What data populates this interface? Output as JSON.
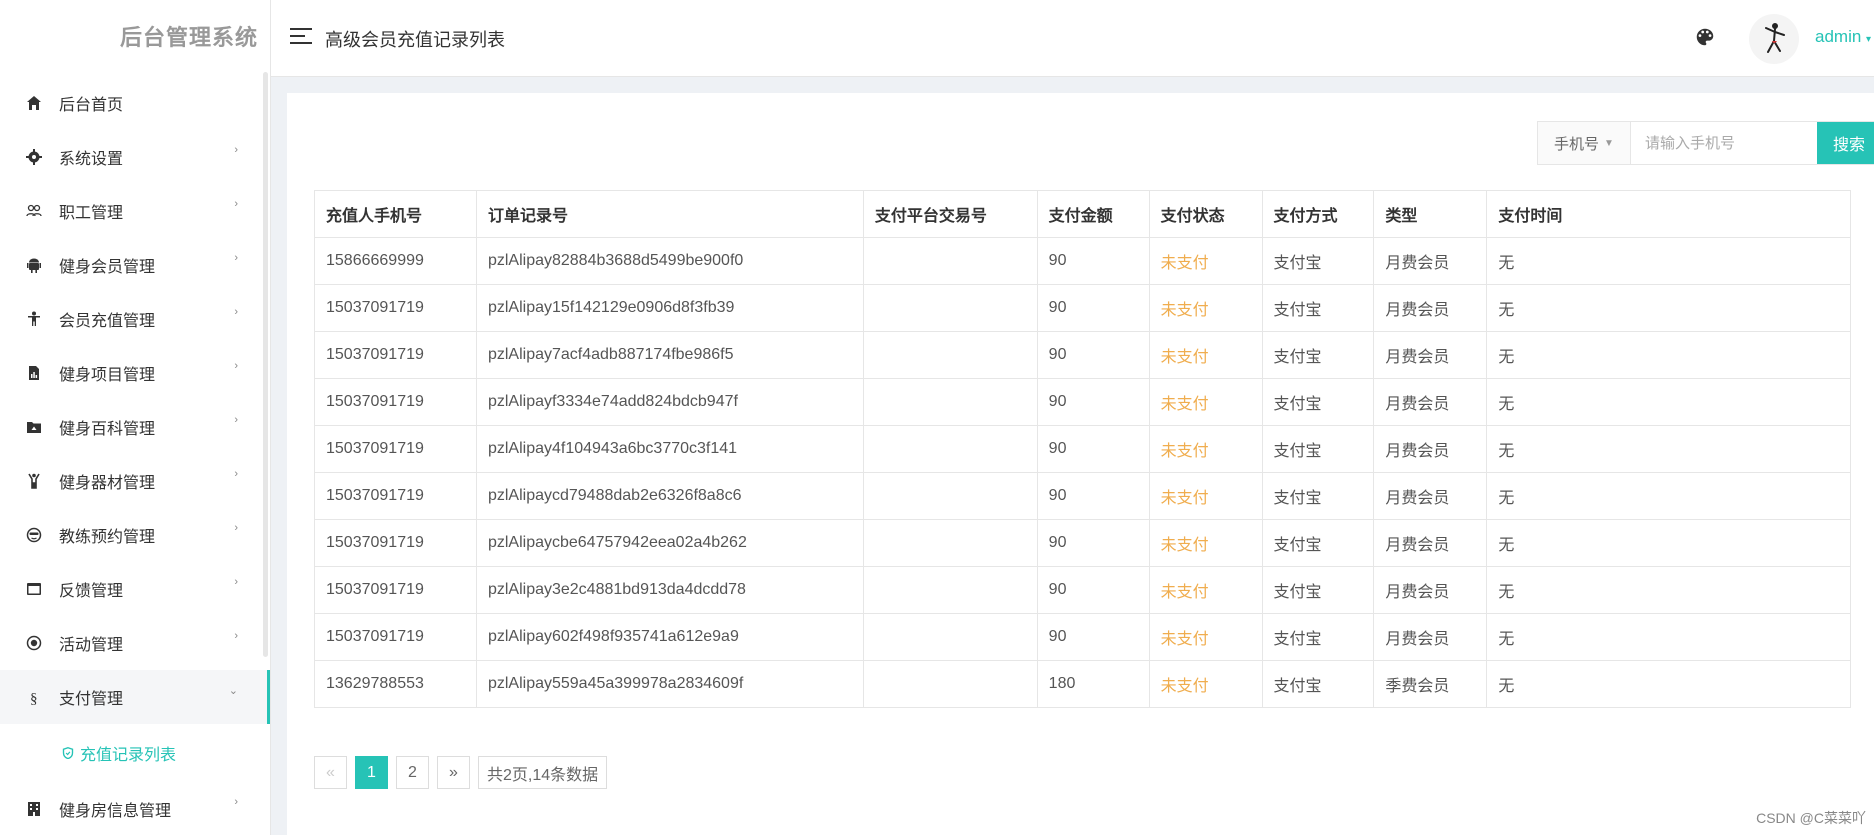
{
  "app": {
    "title": "后台管理系统"
  },
  "header": {
    "title": "高级会员充值记录列表",
    "user": "admin"
  },
  "sidebar": {
    "items": [
      {
        "label": "后台首页",
        "icon": "home-icon",
        "has_arrow": false
      },
      {
        "label": "系统设置",
        "icon": "gear-icon",
        "has_arrow": true
      },
      {
        "label": "职工管理",
        "icon": "users-icon",
        "has_arrow": true
      },
      {
        "label": "健身会员管理",
        "icon": "android-icon",
        "has_arrow": true
      },
      {
        "label": "会员充值管理",
        "icon": "person-icon",
        "has_arrow": true
      },
      {
        "label": "健身项目管理",
        "icon": "file-chart-icon",
        "has_arrow": true
      },
      {
        "label": "健身百科管理",
        "icon": "folder-icon",
        "has_arrow": true
      },
      {
        "label": "健身器材管理",
        "icon": "fitness-icon",
        "has_arrow": true
      },
      {
        "label": "教练预约管理",
        "icon": "face-icon",
        "has_arrow": true
      },
      {
        "label": "反馈管理",
        "icon": "window-icon",
        "has_arrow": true
      },
      {
        "label": "活动管理",
        "icon": "target-icon",
        "has_arrow": true
      },
      {
        "label": "支付管理",
        "icon": "section-icon",
        "has_arrow": true,
        "expanded": true
      },
      {
        "label": "健身房信息管理",
        "icon": "building-icon",
        "has_arrow": true
      }
    ],
    "submenu": {
      "label": "充值记录列表",
      "icon": "shield-icon"
    },
    "arrow_glyph": "›",
    "expanded_glyph": "⌄"
  },
  "search": {
    "field_select": "手机号",
    "placeholder": "请输入手机号",
    "button": "搜索"
  },
  "table": {
    "columns": [
      "充值人手机号",
      "订单记录号",
      "支付平台交易号",
      "支付金额",
      "支付状态",
      "支付方式",
      "类型",
      "支付时间"
    ],
    "rows": [
      [
        "15866669999",
        "pzlAlipay82884b3688d5499be900f0",
        "",
        "90",
        "未支付",
        "支付宝",
        "月费会员",
        "无"
      ],
      [
        "15037091719",
        "pzlAlipay15f142129e0906d8f3fb39",
        "",
        "90",
        "未支付",
        "支付宝",
        "月费会员",
        "无"
      ],
      [
        "15037091719",
        "pzlAlipay7acf4adb887174fbe986f5",
        "",
        "90",
        "未支付",
        "支付宝",
        "月费会员",
        "无"
      ],
      [
        "15037091719",
        "pzlAlipayf3334e74add824bdcb947f",
        "",
        "90",
        "未支付",
        "支付宝",
        "月费会员",
        "无"
      ],
      [
        "15037091719",
        "pzlAlipay4f104943a6bc3770c3f141",
        "",
        "90",
        "未支付",
        "支付宝",
        "月费会员",
        "无"
      ],
      [
        "15037091719",
        "pzlAlipaycd79488dab2e6326f8a8c6",
        "",
        "90",
        "未支付",
        "支付宝",
        "月费会员",
        "无"
      ],
      [
        "15037091719",
        "pzlAlipaycbe64757942eea02a4b262",
        "",
        "90",
        "未支付",
        "支付宝",
        "月费会员",
        "无"
      ],
      [
        "15037091719",
        "pzlAlipay3e2c4881bd913da4dcdd78",
        "",
        "90",
        "未支付",
        "支付宝",
        "月费会员",
        "无"
      ],
      [
        "15037091719",
        "pzlAlipay602f498f935741a612e9a9",
        "",
        "90",
        "未支付",
        "支付宝",
        "月费会员",
        "无"
      ],
      [
        "13629788553",
        "pzlAlipay559a45a399978a2834609f",
        "",
        "180",
        "未支付",
        "支付宝",
        "季费会员",
        "无"
      ]
    ]
  },
  "pagination": {
    "prev": "«",
    "pages": [
      "1",
      "2"
    ],
    "current": "1",
    "next": "»",
    "info": "共2页,14条数据"
  },
  "watermark": "CSDN @C菜菜吖",
  "colors": {
    "accent": "#26c3b6",
    "status_unpaid": "#f0ad4e"
  }
}
